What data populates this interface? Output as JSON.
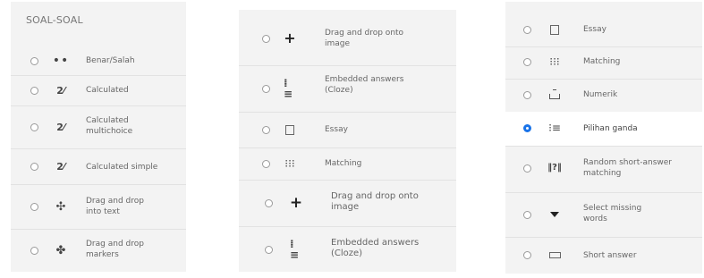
{
  "panel1": {
    "title": "SOAL-SOAL",
    "items": [
      {
        "label": "Benar/Salah",
        "icon": "dots-icon"
      },
      {
        "label": "Calculated",
        "icon": "calculated-icon"
      },
      {
        "label": "Calculated multichoice",
        "icon": "calculated-multichoice-icon"
      },
      {
        "label": "Calculated simple",
        "icon": "calculated-simple-icon"
      },
      {
        "label": "Drag and drop into text",
        "icon": "drag-text-icon"
      },
      {
        "label": "Drag and drop markers",
        "icon": "drag-markers-icon"
      }
    ]
  },
  "panel2": {
    "items": [
      {
        "label": "Drag and drop onto image",
        "icon": "plus-icon"
      },
      {
        "label": "Embedded answers (Cloze)",
        "icon": "cloze-icon"
      },
      {
        "label": "Essay",
        "icon": "essay-icon"
      },
      {
        "label": "Matching",
        "icon": "matching-icon"
      },
      {
        "label": "Drag and drop onto image",
        "icon": "plus-icon"
      },
      {
        "label": "Embedded answers (Cloze)",
        "icon": "cloze-icon"
      }
    ]
  },
  "panel3": {
    "items": [
      {
        "label": "Essay",
        "icon": "essay-icon"
      },
      {
        "label": "Matching",
        "icon": "matching-icon"
      },
      {
        "label": "Numerik",
        "icon": "numerical-icon"
      },
      {
        "label": "Pilihan ganda",
        "icon": "multichoice-icon",
        "selected": true
      },
      {
        "label": "Random short-answer matching",
        "icon": "random-icon"
      },
      {
        "label": "Select missing words",
        "icon": "dropdown-icon"
      },
      {
        "label": "Short answer",
        "icon": "short-answer-icon"
      }
    ]
  },
  "colors": {
    "panel_bg": "#f3f3f3",
    "selected_radio": "#1a73e8",
    "selected_row": "#ffffff"
  }
}
